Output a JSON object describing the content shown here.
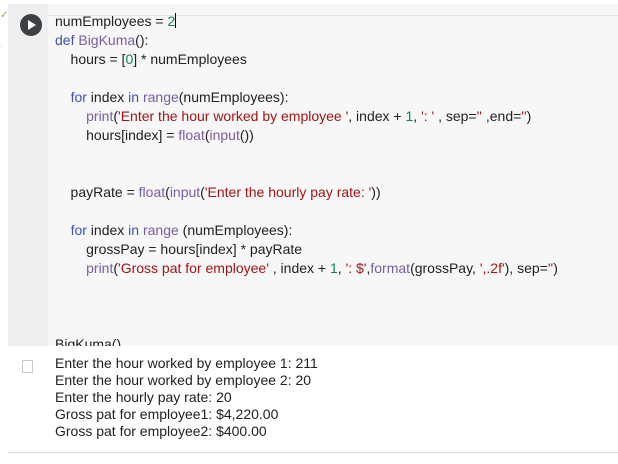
{
  "cell": {
    "code_lines": [
      [
        {
          "t": "numEmployees = ",
          "c": ""
        },
        {
          "t": "2",
          "c": "num"
        },
        {
          "cursor": true
        }
      ],
      [
        {
          "t": "def ",
          "c": "kw"
        },
        {
          "t": "BigKuma",
          "c": "fn"
        },
        {
          "t": "():",
          "c": ""
        }
      ],
      [
        {
          "t": "    hours = [",
          "c": ""
        },
        {
          "t": "0",
          "c": "num"
        },
        {
          "t": "] * numEmployees",
          "c": ""
        }
      ],
      [],
      [
        {
          "t": "    ",
          "c": ""
        },
        {
          "t": "for",
          "c": "kw"
        },
        {
          "t": " index ",
          "c": ""
        },
        {
          "t": "in",
          "c": "kw"
        },
        {
          "t": " ",
          "c": ""
        },
        {
          "t": "range",
          "c": "fn"
        },
        {
          "t": "(numEmployees):",
          "c": ""
        }
      ],
      [
        {
          "t": "        ",
          "c": ""
        },
        {
          "t": "print",
          "c": "fn"
        },
        {
          "t": "(",
          "c": ""
        },
        {
          "t": "'Enter the hour worked by employee '",
          "c": "str"
        },
        {
          "t": ", index + ",
          "c": ""
        },
        {
          "t": "1",
          "c": "num"
        },
        {
          "t": ", ",
          "c": ""
        },
        {
          "t": "': '",
          "c": "str"
        },
        {
          "t": " , sep=",
          "c": ""
        },
        {
          "t": "''",
          "c": "str"
        },
        {
          "t": " ,end=",
          "c": ""
        },
        {
          "t": "''",
          "c": "str"
        },
        {
          "t": ")",
          "c": ""
        }
      ],
      [
        {
          "t": "        hours[index] = ",
          "c": ""
        },
        {
          "t": "float",
          "c": "fn"
        },
        {
          "t": "(",
          "c": ""
        },
        {
          "t": "input",
          "c": "fn"
        },
        {
          "t": "())",
          "c": ""
        }
      ],
      [],
      [],
      [
        {
          "t": "    payRate = ",
          "c": ""
        },
        {
          "t": "float",
          "c": "fn"
        },
        {
          "t": "(",
          "c": ""
        },
        {
          "t": "input",
          "c": "fn"
        },
        {
          "t": "(",
          "c": ""
        },
        {
          "t": "'Enter the hourly pay rate: '",
          "c": "str"
        },
        {
          "t": "))",
          "c": ""
        }
      ],
      [],
      [
        {
          "t": "    ",
          "c": ""
        },
        {
          "t": "for",
          "c": "kw"
        },
        {
          "t": " index ",
          "c": ""
        },
        {
          "t": "in",
          "c": "kw"
        },
        {
          "t": " ",
          "c": ""
        },
        {
          "t": "range",
          "c": "fn"
        },
        {
          "t": " (numEmployees):",
          "c": ""
        }
      ],
      [
        {
          "t": "        grossPay = hours[index] * payRate",
          "c": ""
        }
      ],
      [
        {
          "t": "        ",
          "c": ""
        },
        {
          "t": "print",
          "c": "fn"
        },
        {
          "t": "(",
          "c": ""
        },
        {
          "t": "'Gross pat for employee'",
          "c": "str"
        },
        {
          "t": " , index + ",
          "c": ""
        },
        {
          "t": "1",
          "c": "num"
        },
        {
          "t": ", ",
          "c": ""
        },
        {
          "t": "': $'",
          "c": "str"
        },
        {
          "t": ",",
          "c": ""
        },
        {
          "t": "format",
          "c": "fn"
        },
        {
          "t": "(grossPay, ",
          "c": ""
        },
        {
          "t": "',.2f'",
          "c": "str"
        },
        {
          "t": "), sep=",
          "c": ""
        },
        {
          "t": "''",
          "c": "str"
        },
        {
          "t": ")",
          "c": ""
        }
      ],
      [],
      [],
      [],
      [
        {
          "t": "BigKuma()",
          "c": ""
        }
      ]
    ],
    "output_lines": [
      "Enter the hour worked by employee 1: 211",
      "Enter the hour worked by employee 2: 20",
      "Enter the hourly pay rate: 20",
      "Gross pat for employee1: $4,220.00",
      "Gross pat for employee2: $400.00"
    ]
  },
  "icons": {
    "run": "play-icon",
    "output": "clear-output-icon",
    "status": "check-icon"
  },
  "colors": {
    "keyword": "#3f51b5",
    "function": "#795da3",
    "string": "#a31515",
    "number": "#098658"
  }
}
